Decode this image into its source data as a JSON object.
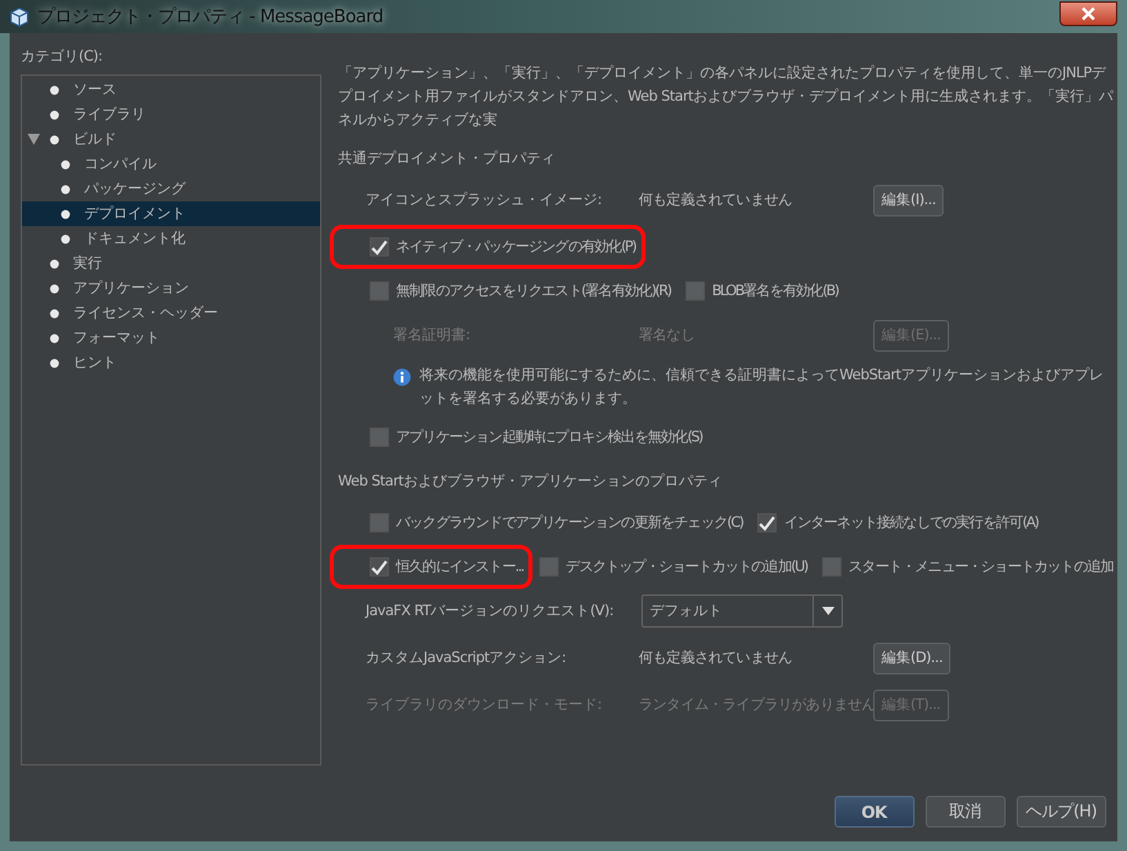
{
  "window": {
    "title": "プロジェクト・プロパティ - MessageBoard"
  },
  "categories": {
    "label": "カテゴリ(C):",
    "items": [
      {
        "label": "ソース",
        "selected": false
      },
      {
        "label": "ライブラリ",
        "selected": false
      },
      {
        "label": "ビルド",
        "selected": false,
        "expanded": true,
        "children": [
          {
            "label": "コンパイル",
            "selected": false
          },
          {
            "label": "パッケージング",
            "selected": false
          },
          {
            "label": "デプロイメント",
            "selected": true
          },
          {
            "label": "ドキュメント化",
            "selected": false
          }
        ]
      },
      {
        "label": "実行",
        "selected": false
      },
      {
        "label": "アプリケーション",
        "selected": false
      },
      {
        "label": "ライセンス・ヘッダー",
        "selected": false
      },
      {
        "label": "フォーマット",
        "selected": false
      },
      {
        "label": "ヒント",
        "selected": false
      }
    ]
  },
  "description": "「アプリケーション」、「実行」、「デプロイメント」の各パネルに設定されたプロパティを使用して、単一のJNLPデプロイメント用ファイルがスタンドアロン、Web Startおよびブラウザ・デプロイメント用に生成されます。「実行」パネルからアクティブな実",
  "sections": [
    {
      "title": "共通デプロイメント・プロパティ",
      "rows": [
        {
          "kind": "value",
          "label": "アイコンとスプラッシュ・イメージ:",
          "value": "何も定義されていません",
          "button": {
            "label": "編集(I)...",
            "disabled": false
          },
          "disabled": false,
          "indented": false
        },
        {
          "kind": "checks",
          "items": [
            {
              "label": "ネイティブ・パッケージングの有効化(P)",
              "checked": true,
              "highlighted": true
            }
          ]
        },
        {
          "kind": "checks",
          "items": [
            {
              "label": "無制限のアクセスをリクエスト(署名有効化)(R)",
              "checked": false,
              "highlighted": false
            },
            {
              "label": "BLOB署名を有効化(B)",
              "checked": false,
              "highlighted": false
            }
          ]
        },
        {
          "kind": "value",
          "label": "署名証明書:",
          "value": "署名なし",
          "button": {
            "label": "編集(E)...",
            "disabled": true
          },
          "disabled": true,
          "indented": true
        },
        {
          "kind": "info",
          "text": "将来の機能を使用可能にするために、信頼できる証明書によってWebStartアプリケーションおよびアプレットを署名する必要があります。"
        },
        {
          "kind": "checks",
          "items": [
            {
              "label": "アプリケーション起動時にプロキシ検出を無効化(S)",
              "checked": false,
              "highlighted": false
            }
          ]
        }
      ]
    },
    {
      "title": "Web Startおよびブラウザ・アプリケーションのプロパティ",
      "rows": [
        {
          "kind": "checks",
          "items": [
            {
              "label": "バックグラウンドでアプリケーションの更新をチェック(C)",
              "checked": false,
              "highlighted": false
            },
            {
              "label": "インターネット接続なしでの実行を許可(A)",
              "checked": true,
              "highlighted": false
            }
          ]
        },
        {
          "kind": "checks",
          "items": [
            {
              "label": "恒久的にインストー...",
              "checked": true,
              "highlighted": true
            },
            {
              "label": "デスクトップ・ショートカットの追加(U)",
              "checked": false,
              "highlighted": false
            },
            {
              "label": "スタート・メニュー・ショートカットの追加",
              "checked": false,
              "highlighted": false
            }
          ]
        },
        {
          "kind": "select",
          "label": "JavaFX RTバージョンのリクエスト(V):",
          "value": "デフォルト"
        },
        {
          "kind": "value",
          "label": "カスタムJavaScriptアクション:",
          "value": "何も定義されていません",
          "button": {
            "label": "編集(D)...",
            "disabled": false
          },
          "disabled": false,
          "indented": false
        },
        {
          "kind": "value",
          "label": "ライブラリのダウンロード・モード:",
          "value": "ランタイム・ライブラリがありません",
          "button": {
            "label": "編集(T)...",
            "disabled": true
          },
          "disabled": true,
          "indented": false
        }
      ]
    }
  ],
  "buttons": [
    {
      "label": "OK",
      "primary": true
    },
    {
      "label": "取消",
      "primary": false
    },
    {
      "label": "ヘルプ(H)",
      "primary": false
    }
  ]
}
